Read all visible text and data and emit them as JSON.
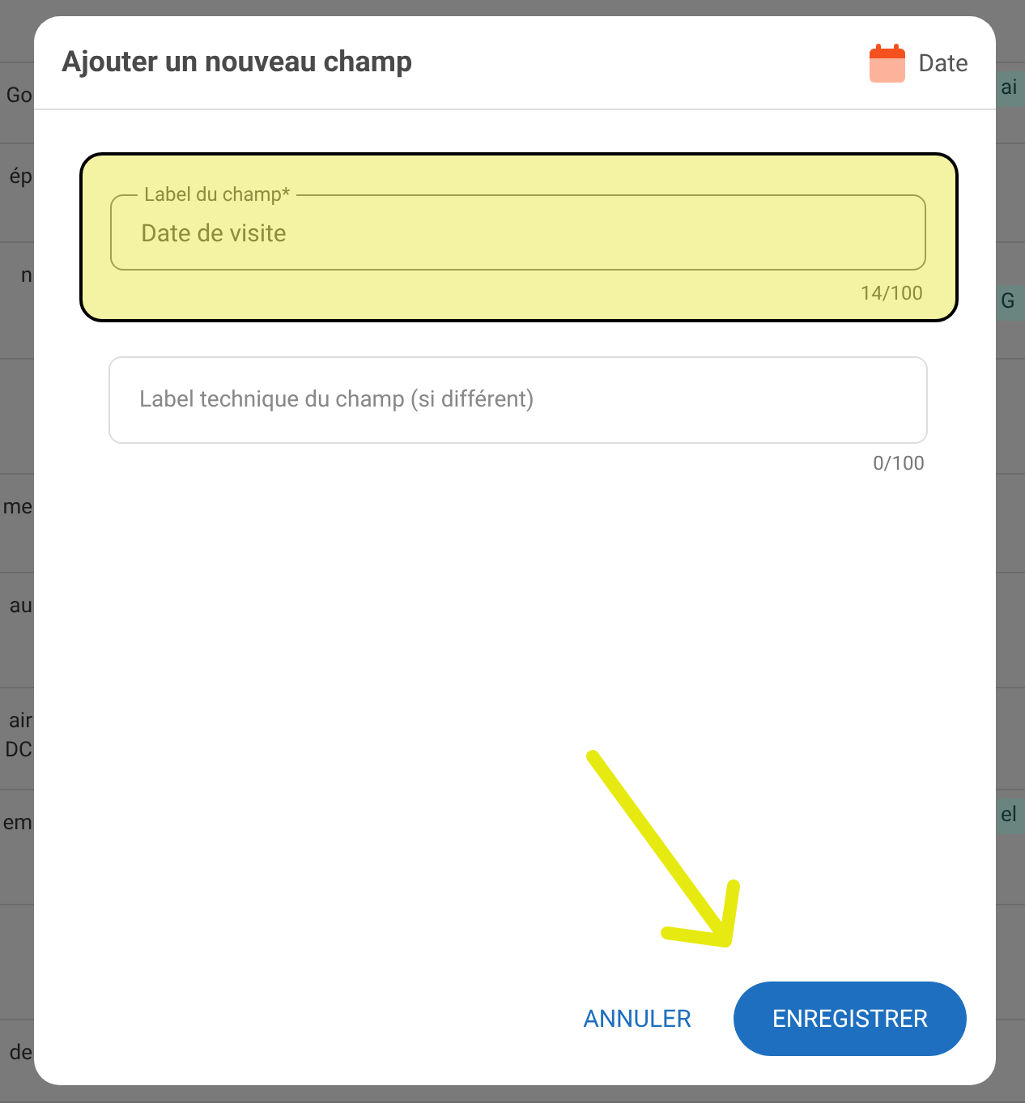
{
  "background_rows": [
    {
      "left": [],
      "right": ""
    },
    {
      "left": [
        "Go"
      ],
      "right": "ai"
    },
    {
      "left": [
        "ép"
      ],
      "right": ""
    },
    {
      "left": [
        "n"
      ],
      "right": "G"
    },
    {
      "left": [],
      "right": ""
    },
    {
      "left": [
        "me"
      ],
      "right": ""
    },
    {
      "left": [
        "au"
      ],
      "right": ""
    },
    {
      "left": [
        "air",
        "DC"
      ],
      "right": ""
    },
    {
      "left": [
        "em"
      ],
      "right": "el"
    },
    {
      "left": [],
      "right": ""
    },
    {
      "left": [
        "de"
      ],
      "right": ""
    }
  ],
  "dialog": {
    "title": "Ajouter un nouveau champ",
    "type_label": "Date",
    "fields": [
      {
        "label": "Label du champ*",
        "value": "Date de visite",
        "counter": "14/100",
        "highlighted": true
      },
      {
        "placeholder": "Label technique du champ (si différent)",
        "counter": "0/100",
        "highlighted": false
      }
    ],
    "buttons": [
      {
        "label": "ANNULER",
        "kind": "text"
      },
      {
        "label": "ENREGISTRER",
        "kind": "filled"
      }
    ]
  },
  "annotations": [
    {
      "kind": "arrow"
    }
  ]
}
